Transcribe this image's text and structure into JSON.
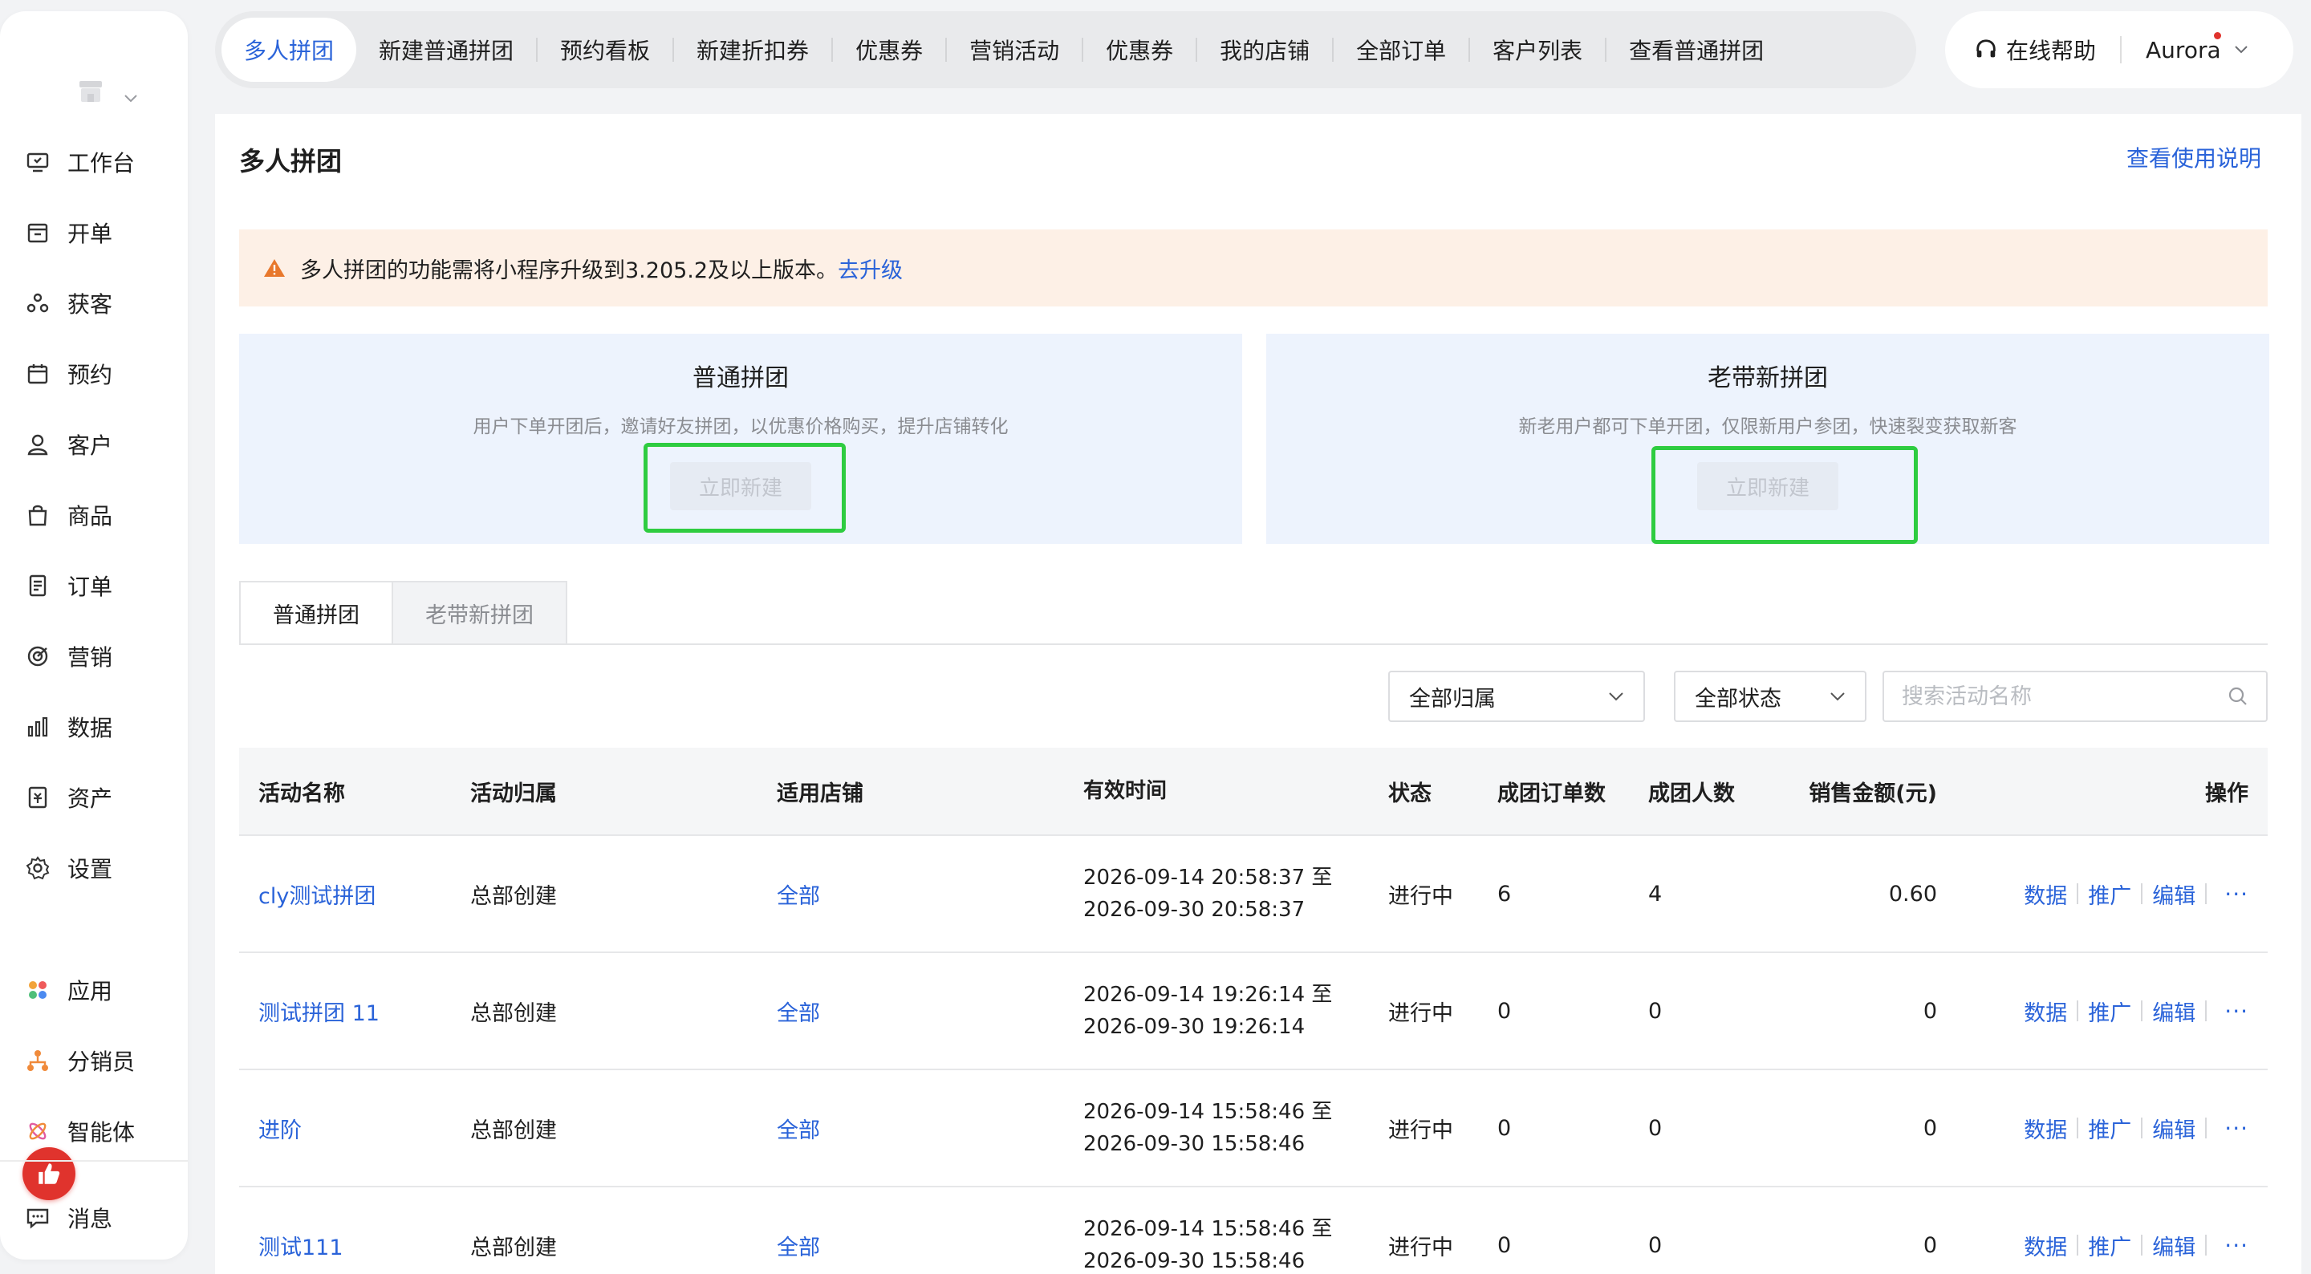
{
  "sidebar": {
    "items": [
      {
        "label": "工作台",
        "icon": "workbench-icon"
      },
      {
        "label": "开单",
        "icon": "billing-icon"
      },
      {
        "label": "获客",
        "icon": "acquire-icon"
      },
      {
        "label": "预约",
        "icon": "calendar-icon"
      },
      {
        "label": "客户",
        "icon": "user-icon"
      },
      {
        "label": "商品",
        "icon": "bag-icon"
      },
      {
        "label": "订单",
        "icon": "order-icon"
      },
      {
        "label": "营销",
        "icon": "target-icon"
      },
      {
        "label": "数据",
        "icon": "bar-chart-icon"
      },
      {
        "label": "资产",
        "icon": "asset-icon"
      },
      {
        "label": "设置",
        "icon": "gear-icon"
      },
      {
        "label": "应用",
        "icon": "apps-icon"
      },
      {
        "label": "分销员",
        "icon": "distributor-icon"
      },
      {
        "label": "智能体",
        "icon": "agent-icon"
      },
      {
        "label": "消息",
        "icon": "message-icon"
      }
    ]
  },
  "topnav": {
    "tabs": [
      "多人拼团",
      "新建普通拼团",
      "预约看板",
      "新建折扣券",
      "优惠券",
      "营销活动",
      "优惠券",
      "我的店铺",
      "全部订单",
      "客户列表",
      "查看普通拼团"
    ],
    "help": "在线帮助",
    "user": "Aurora"
  },
  "page": {
    "title": "多人拼团",
    "help_link": "查看使用说明",
    "notice_text": "多人拼团的功能需将小程序升级到3.205.2及以上版本。",
    "notice_link": "去升级"
  },
  "cards": [
    {
      "title": "普通拼团",
      "desc": "用户下单开团后，邀请好友拼团，以优惠价格购买，提升店铺转化",
      "button": "立即新建"
    },
    {
      "title": "老带新拼团",
      "desc": "新老用户都可下单开团，仅限新用户参团，快速裂变获取新客",
      "button": "立即新建"
    }
  ],
  "segments": [
    "普通拼团",
    "老带新拼团"
  ],
  "filters": {
    "owner": "全部归属",
    "status": "全部状态",
    "search_placeholder": "搜索活动名称"
  },
  "table": {
    "headers": [
      "活动名称",
      "活动归属",
      "适用店铺",
      "有效时间",
      "状态",
      "成团订单数",
      "成团人数",
      "销售金额(元)",
      "操作"
    ],
    "ops": [
      "数据",
      "推广",
      "编辑",
      "···"
    ],
    "rows": [
      {
        "name": "cly测试拼团",
        "owner": "总部创建",
        "store": "全部",
        "time1": "2026-09-14 20:58:37 至",
        "time2": "2026-09-30 20:58:37",
        "status": "进行中",
        "orders": "6",
        "people": "4",
        "amount": "0.60"
      },
      {
        "name": "测试拼团 11",
        "owner": "总部创建",
        "store": "全部",
        "time1": "2026-09-14 19:26:14 至",
        "time2": "2026-09-30 19:26:14",
        "status": "进行中",
        "orders": "0",
        "people": "0",
        "amount": "0"
      },
      {
        "name": "进阶",
        "owner": "总部创建",
        "store": "全部",
        "time1": "2026-09-14 15:58:46 至",
        "time2": "2026-09-30 15:58:46",
        "status": "进行中",
        "orders": "0",
        "people": "0",
        "amount": "0"
      },
      {
        "name": "测试111",
        "owner": "总部创建",
        "store": "全部",
        "time1": "2026-09-14 15:58:46 至",
        "time2": "2026-09-30 15:58:46",
        "status": "进行中",
        "orders": "0",
        "people": "0",
        "amount": "0"
      }
    ]
  },
  "colors": {
    "accent": "#2a63d9",
    "warning_bg": "#fdf0e6",
    "card_bg": "#edf3fd",
    "highlight": "#2ecc40",
    "badge": "#e0332d"
  }
}
